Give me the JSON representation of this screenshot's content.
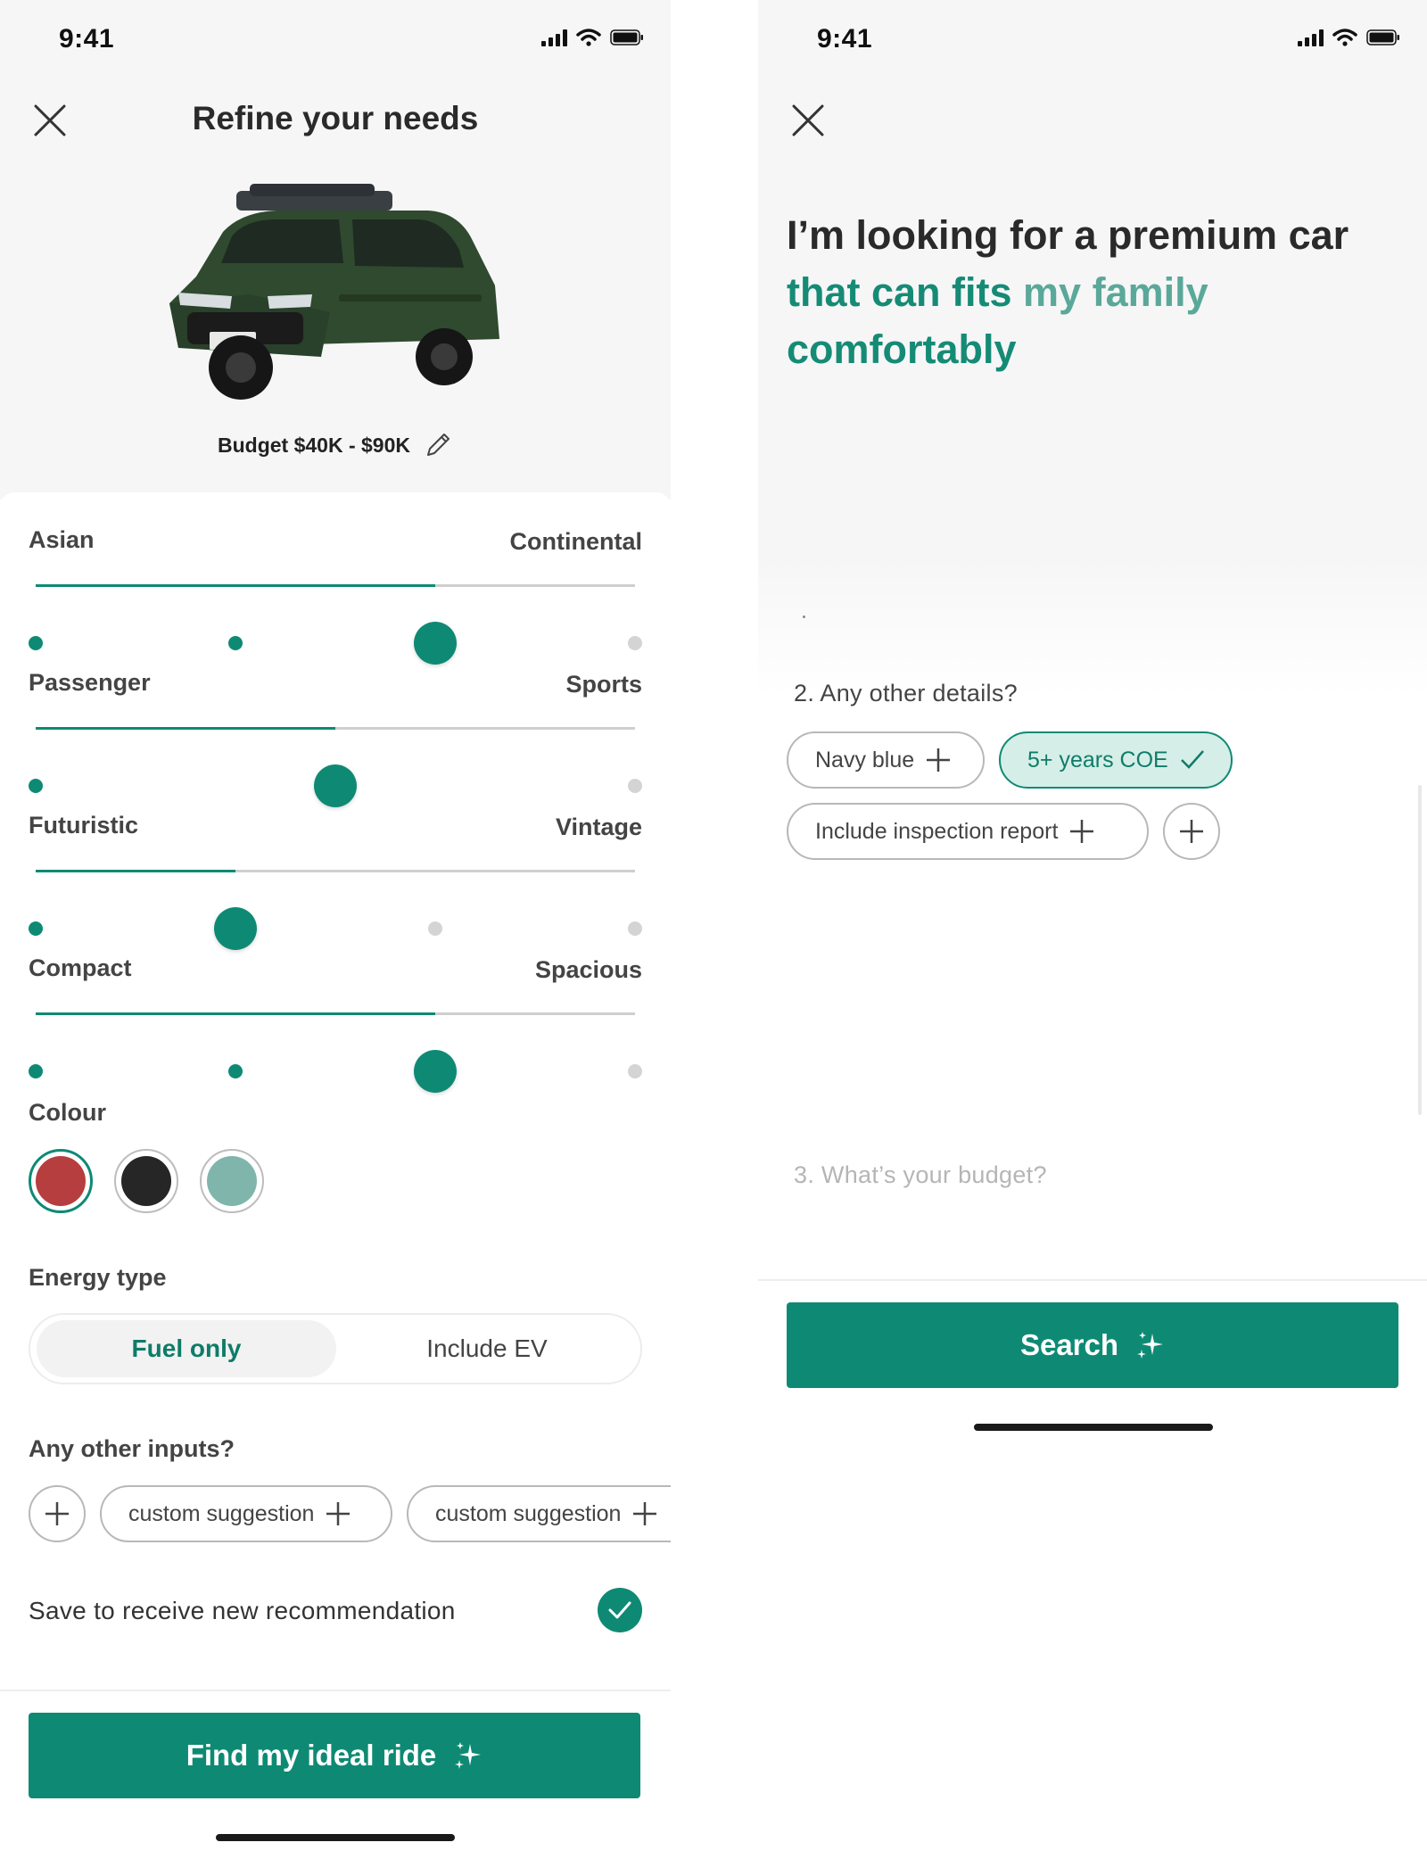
{
  "left": {
    "status_time": "9:41",
    "title": "Refine your needs",
    "budget": "Budget $40K - $90K",
    "sliders": [
      {
        "left": "Asian",
        "right": "Continental",
        "level": 0.667
      },
      {
        "left": "Passenger",
        "right": "Sports",
        "level": 0.5
      },
      {
        "left": "Futuristic",
        "right": "Vintage",
        "level": 0.333
      },
      {
        "left": "Compact",
        "right": "Spacious",
        "level": 0.667
      }
    ],
    "colour_label": "Colour",
    "colours": [
      "#b63e3f",
      "#262626",
      "#7fb5ab"
    ],
    "selected_colour": "#b63e3f",
    "energy_label": "Energy type",
    "energy_options": [
      "Fuel only",
      "Include EV"
    ],
    "energy_selected": "Fuel only",
    "other_label": "Any other inputs?",
    "suggestions": [
      "custom suggestion",
      "custom suggestion"
    ],
    "save_text": "Save to receive new recommendation",
    "save_checked": true,
    "cta": "Find my ideal ride"
  },
  "right": {
    "status_time": "9:41",
    "prompt_line1": "I’m looking for a premium car",
    "prompt_line2a": "that can fits ",
    "prompt_line2b": "my family",
    "prompt_line3": "comfortably",
    "q2": "2.  Any other details?",
    "chips": [
      "Navy blue",
      "5+ years COE",
      "Include inspection report"
    ],
    "selected_chip": "5+ years COE",
    "q3": "3.  What’s your budget?",
    "cta": "Search"
  },
  "colors": {
    "accent": "#0e8a74",
    "accent_light": "#d5eee8"
  }
}
